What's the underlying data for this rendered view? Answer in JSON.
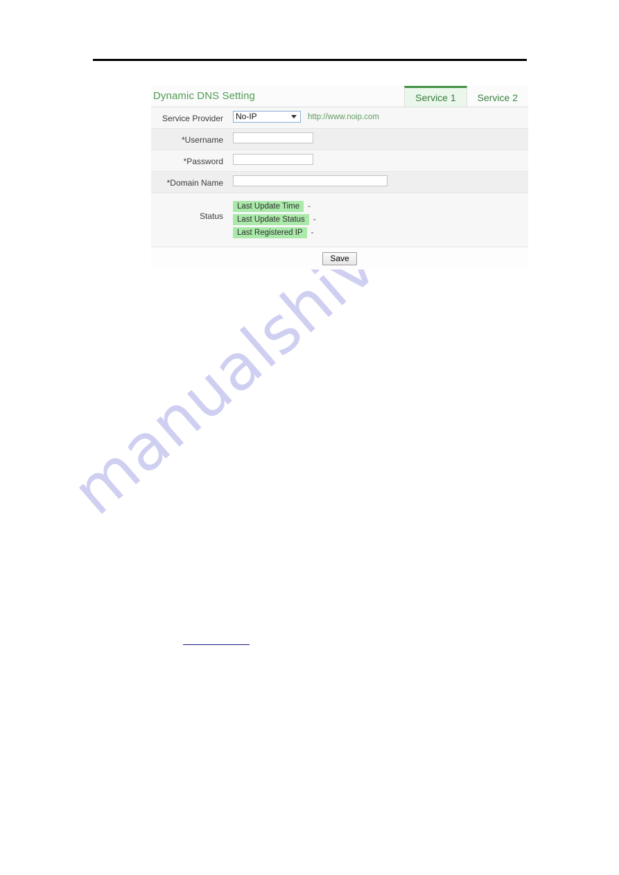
{
  "page": {
    "rule": "horizontal-rule",
    "watermark": "manualshive.com",
    "footer_link_text": ""
  },
  "panel": {
    "title": "Dynamic DNS Setting",
    "tabs": [
      {
        "label": "Service 1",
        "active": true
      },
      {
        "label": "Service 2",
        "active": false
      }
    ],
    "rows": {
      "service_provider": {
        "label": "Service Provider",
        "selected": "No-IP",
        "options": [
          "No-IP"
        ],
        "url": "http://www.noip.com"
      },
      "username": {
        "label": "*Username",
        "value": "",
        "placeholder": ""
      },
      "password": {
        "label": "*Password",
        "value": "",
        "placeholder": ""
      },
      "domain_name": {
        "label": "*Domain Name",
        "value": "",
        "placeholder": ""
      },
      "status": {
        "label": "Status",
        "items": [
          {
            "badge": "Last Update Time",
            "value": "-"
          },
          {
            "badge": "Last Update Status",
            "value": "-"
          },
          {
            "badge": "Last Registered IP",
            "value": "-"
          }
        ]
      }
    },
    "save_label": "Save"
  },
  "colors": {
    "title_green": "#4f9a53",
    "tab_active_bg": "#eaf7ea",
    "tab_active_border": "#3f8f43",
    "badge_green": "#aae9aa",
    "url_green": "#5f9c5f",
    "watermark": "#cfcff2",
    "link_blue": "#151585"
  }
}
